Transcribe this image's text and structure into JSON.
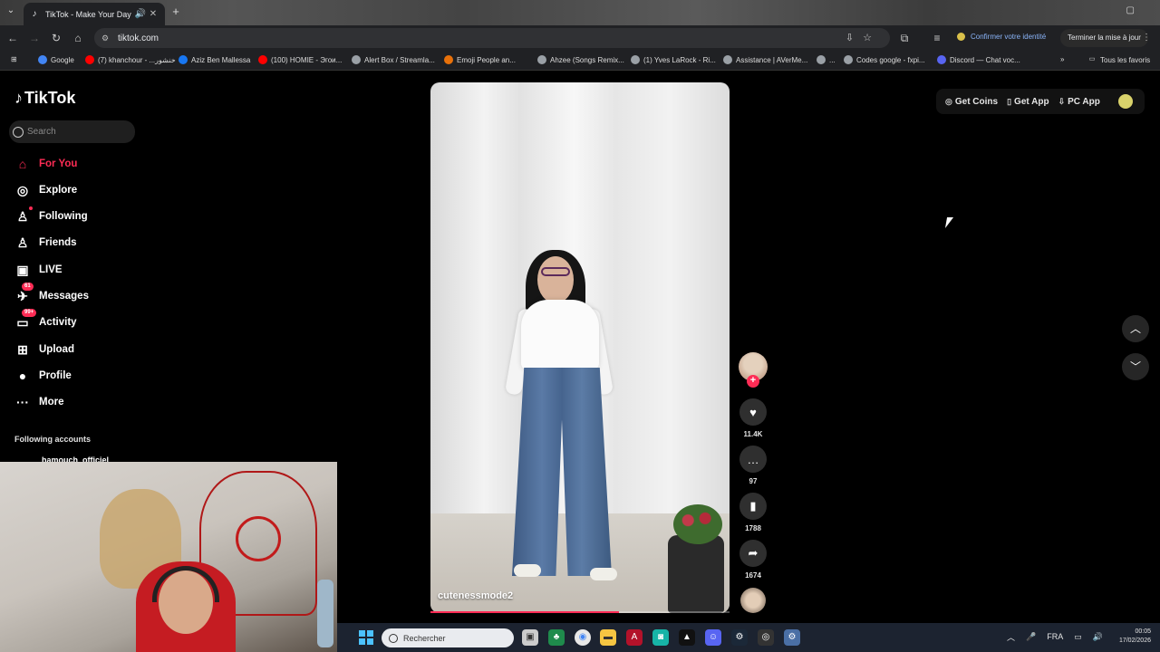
{
  "browser": {
    "tab_title": "TikTok - Make Your Day",
    "url": "tiktok.com",
    "identity_label": "Confirmer votre identité",
    "update_label": "Terminer la mise à jour",
    "bookmarks": [
      {
        "label": "Google",
        "color": "#4285f4"
      },
      {
        "label": "(7) khanchour - ...خنشور",
        "color": "#ff0000"
      },
      {
        "label": "Aziz Ben Mallessa",
        "color": "#1877f2"
      },
      {
        "label": "(100) HOMIE - Эгои...",
        "color": "#ff0000"
      },
      {
        "label": "Alert Box / Streamla...",
        "color": "#9aa0a6"
      },
      {
        "label": "Emoji People an...",
        "color": "#e8710a"
      },
      {
        "label": "Ahzee (Songs Remix...",
        "color": "#9aa0a6"
      },
      {
        "label": "(1) Yves LaRock - Ri...",
        "color": "#9aa0a6"
      },
      {
        "label": "Assistance | AVerMe...",
        "color": "#9aa0a6"
      },
      {
        "label": "...",
        "color": "#9aa0a6"
      },
      {
        "label": "Codes google - fxpi...",
        "color": "#9aa0a6"
      },
      {
        "label": "Discord — Chat voc...",
        "color": "#5865f2"
      }
    ],
    "all_bookmarks_label": "Tous les favoris"
  },
  "tiktok": {
    "logo": "TikTok",
    "search_placeholder": "Search",
    "nav": [
      {
        "label": "For You",
        "icon": "home-icon",
        "glyph": "⌂"
      },
      {
        "label": "Explore",
        "icon": "compass-icon",
        "glyph": "◎"
      },
      {
        "label": "Following",
        "icon": "following-icon",
        "glyph": "♙"
      },
      {
        "label": "Friends",
        "icon": "friends-icon",
        "glyph": "♙"
      },
      {
        "label": "LIVE",
        "icon": "live-icon",
        "glyph": "▣"
      },
      {
        "label": "Messages",
        "icon": "messages-icon",
        "glyph": "✈",
        "badge": "61"
      },
      {
        "label": "Activity",
        "icon": "activity-icon",
        "glyph": "▭",
        "badge": "99+"
      },
      {
        "label": "Upload",
        "icon": "upload-icon",
        "glyph": "⊞"
      },
      {
        "label": "Profile",
        "icon": "profile-icon",
        "glyph": "●"
      },
      {
        "label": "More",
        "icon": "more-icon",
        "glyph": "···"
      }
    ],
    "following_accounts_title": "Following accounts",
    "following_accounts": [
      "hamouch_officiel"
    ],
    "video": {
      "username": "cutenessmode2",
      "progress": 0.63,
      "likes": "11.4K",
      "comments": "97",
      "bookmarks": "1788",
      "shares": "1674"
    },
    "top_actions": {
      "coins": "Get Coins",
      "app": "Get App",
      "pc_app": "PC App"
    }
  },
  "taskbar": {
    "search_placeholder": "Rechercher",
    "language": "FRA",
    "time": "00:05",
    "date": "17/02/2026"
  }
}
